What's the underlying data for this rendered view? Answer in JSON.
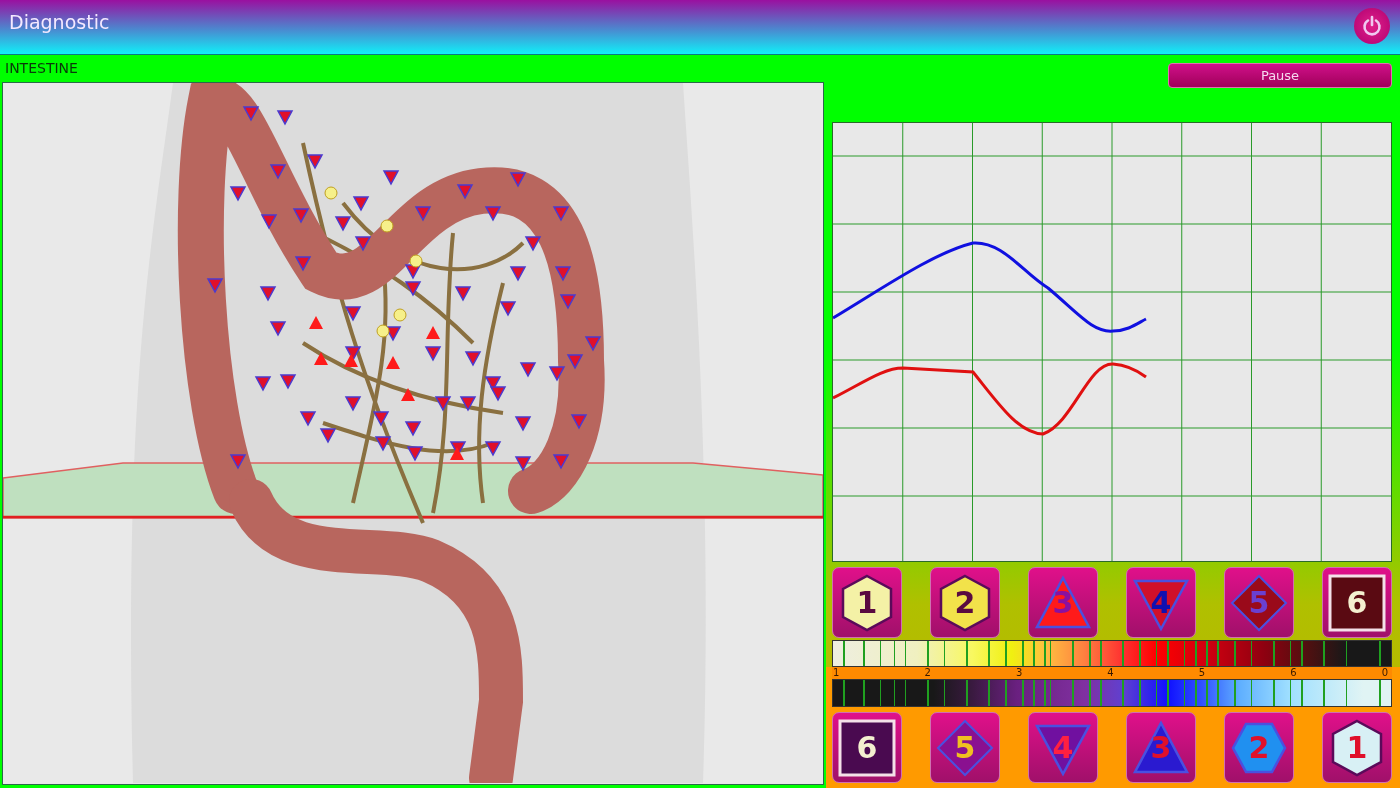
{
  "window": {
    "title": "Diagnostic"
  },
  "organ_label": "INTESTINE",
  "pause_button": "Pause",
  "upper_buttons": [
    {
      "label": "1",
      "kind": "hexagon",
      "color": "#f4f1a6"
    },
    {
      "label": "2",
      "kind": "hexagon",
      "color": "#f2e24a"
    },
    {
      "label": "3",
      "kind": "triangle",
      "color": "#ff1a1a"
    },
    {
      "label": "4",
      "kind": "inverted-triangle",
      "color": "#d0102a"
    },
    {
      "label": "5",
      "kind": "diamond",
      "color": "#9a0a1a"
    },
    {
      "label": "6",
      "kind": "square",
      "color": "#5a0a12"
    }
  ],
  "scale_labels": [
    "1",
    "2",
    "3",
    "4",
    "5",
    "6",
    "0"
  ],
  "lower_buttons": [
    {
      "label": "6",
      "kind": "square",
      "color": "#4a0a50"
    },
    {
      "label": "5",
      "kind": "diamond",
      "color": "#8a1090"
    },
    {
      "label": "4",
      "kind": "inverted-triangle",
      "color": "#7010a0"
    },
    {
      "label": "3",
      "kind": "triangle",
      "color": "#2a1ad0"
    },
    {
      "label": "2",
      "kind": "hexagon",
      "color": "#2090f0"
    },
    {
      "label": "1",
      "kind": "hexagon",
      "color": "#d8f0f5"
    }
  ]
}
